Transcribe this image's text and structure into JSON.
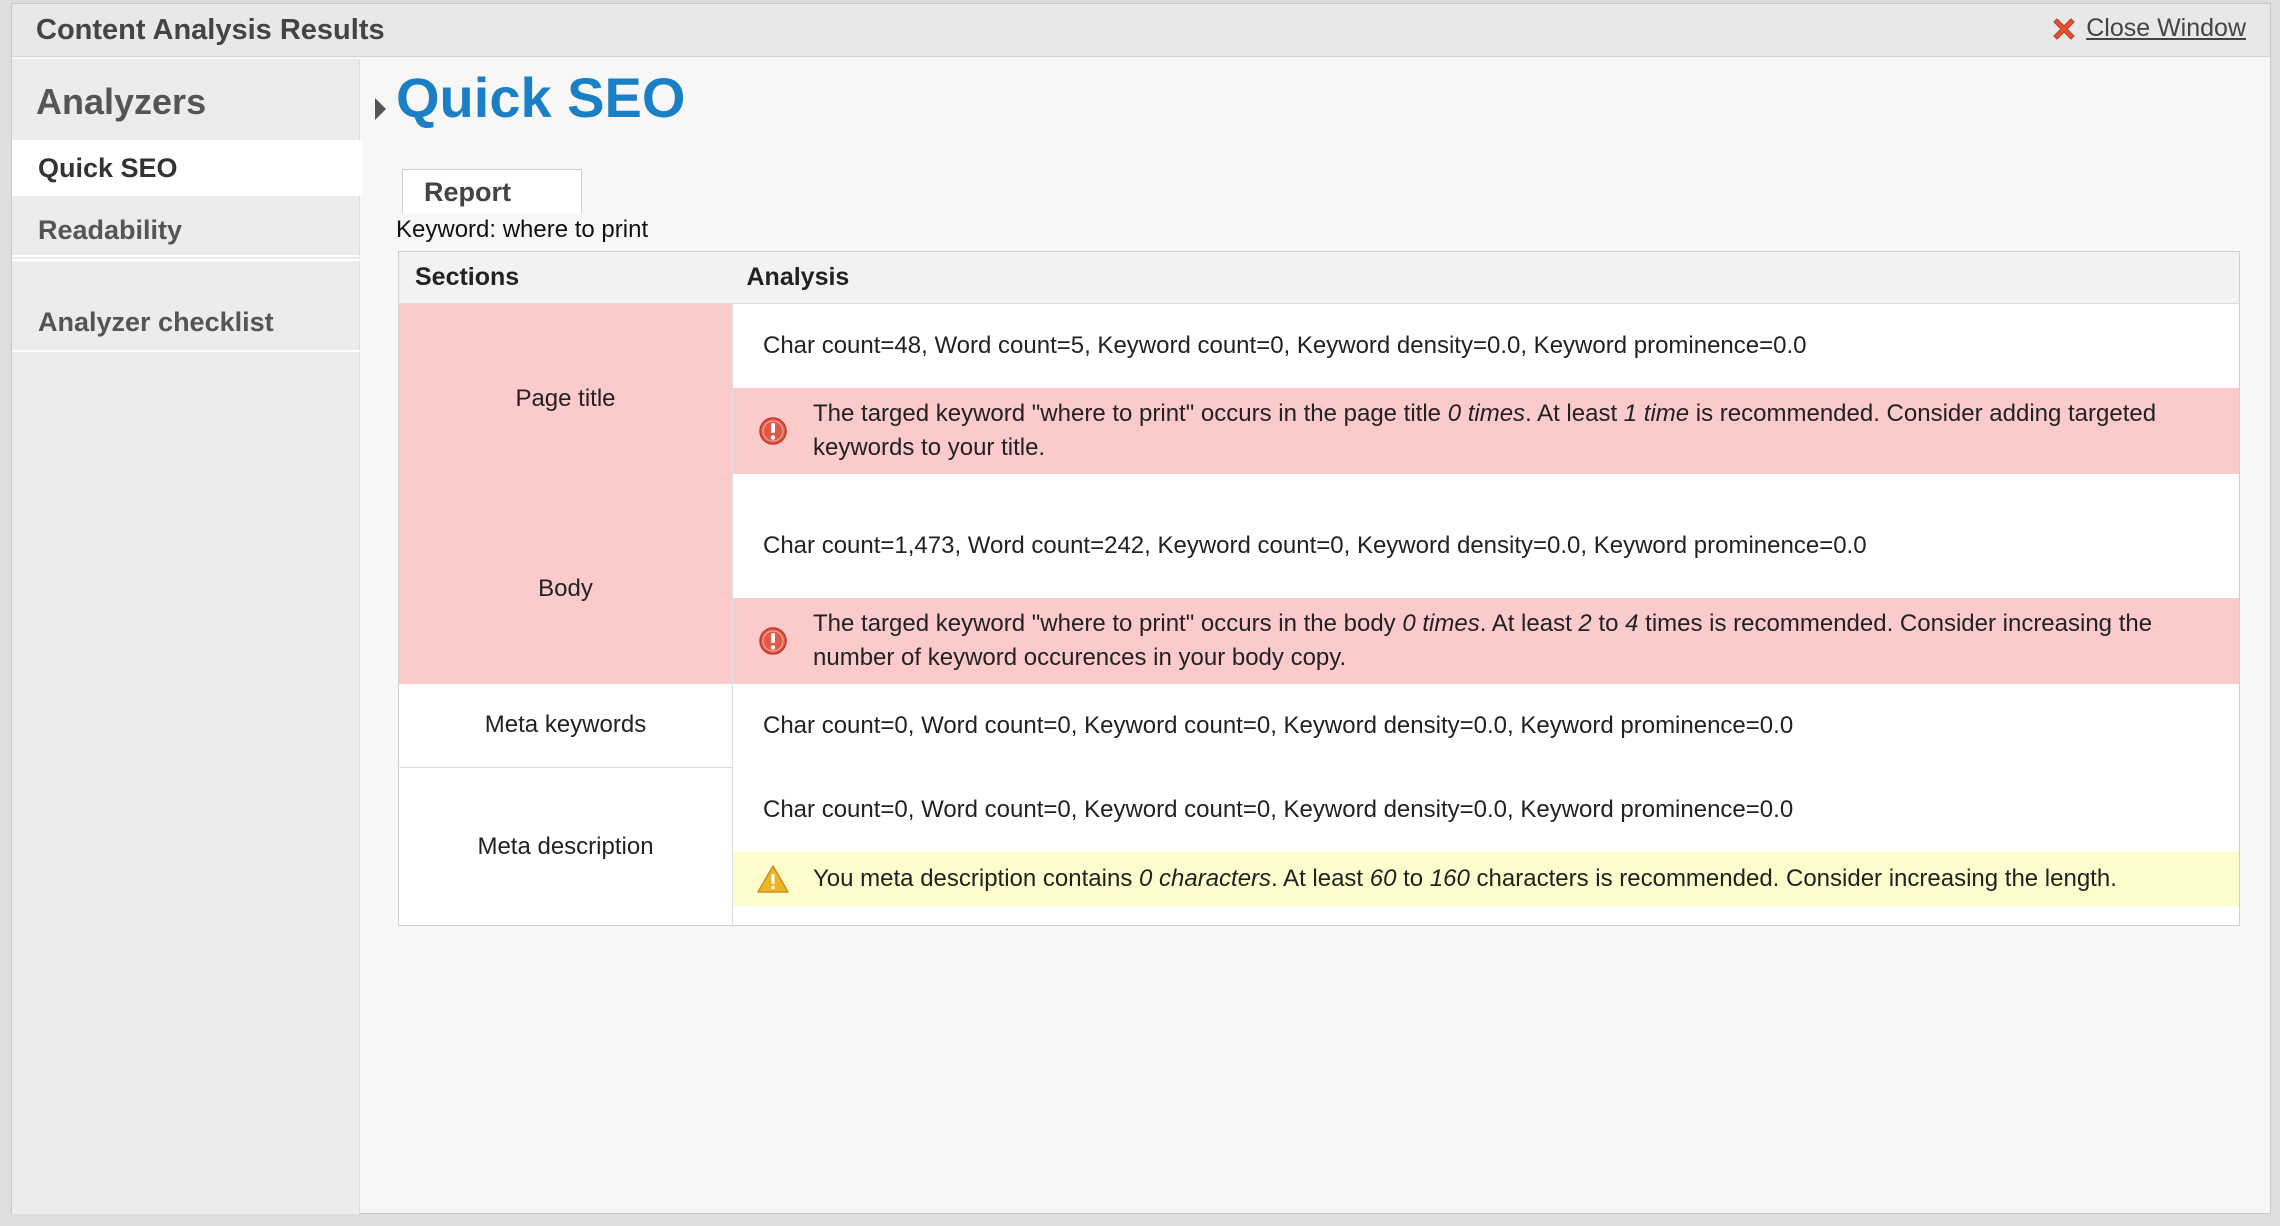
{
  "window": {
    "title": "Content Analysis Results",
    "close_label": "Close Window",
    "close_icon": "close-x-icon"
  },
  "sidebar": {
    "heading": "Analyzers",
    "items": [
      {
        "label": "Quick SEO",
        "active": true
      },
      {
        "label": "Readability",
        "active": false
      },
      {
        "label": "Analyzer checklist",
        "active": false
      }
    ]
  },
  "main": {
    "title": "Quick SEO",
    "tab_label": "Report",
    "keyword_line": "Keyword: where to print",
    "columns": [
      "Sections",
      "Analysis"
    ],
    "rows": [
      {
        "section": "Page title",
        "status": "error",
        "stats": "Char count=48, Word count=5, Keyword count=0, Keyword density=0.0, Keyword prominence=0.0",
        "message": {
          "type": "error",
          "p1": "The targed keyword \"where to print\" occurs in the page title ",
          "e1": "0 times",
          "p2": ". At least ",
          "e2": "1 time",
          "p3": " is recommended. Consider adding targeted keywords to your title."
        }
      },
      {
        "section": "Body",
        "status": "error",
        "stats": "Char count=1,473, Word count=242, Keyword count=0, Keyword density=0.0, Keyword prominence=0.0",
        "message": {
          "type": "error",
          "p1": "The targed keyword \"where to print\" occurs in the body ",
          "e1": "0 times",
          "p2": ". At least ",
          "e2": "2",
          "p3": " to ",
          "e3": "4",
          "p4": " times is recommended. Consider increasing the number of keyword occurences in your body copy."
        }
      },
      {
        "section": "Meta keywords",
        "status": "ok",
        "stats": "Char count=0, Word count=0, Keyword count=0, Keyword density=0.0, Keyword prominence=0.0"
      },
      {
        "section": "Meta description",
        "status": "ok",
        "stats": "Char count=0, Word count=0, Keyword count=0, Keyword density=0.0, Keyword prominence=0.0",
        "message": {
          "type": "warning",
          "p1": "You meta description contains ",
          "e1": "0 characters",
          "p2": ". At least ",
          "e2": "60",
          "p3": " to ",
          "e3": "160",
          "p4": " characters is recommended. Consider increasing the length."
        }
      }
    ]
  },
  "colors": {
    "title_blue": "#1a7fc4",
    "error_bg": "#fbcaca",
    "warning_bg": "#fdfccc",
    "error_icon": "#e05a4a",
    "warning_icon": "#f0b429"
  }
}
